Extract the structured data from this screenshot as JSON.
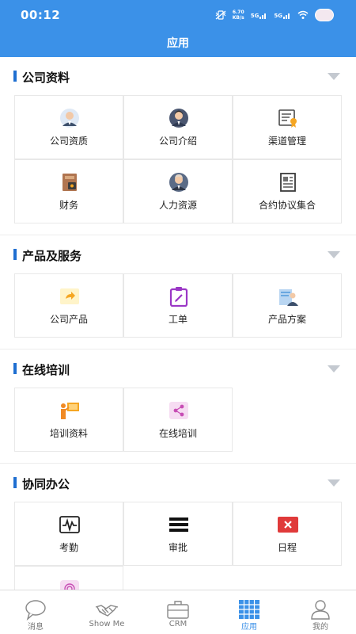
{
  "status_bar": {
    "time": "00:12",
    "net_speed": "6.70",
    "net_unit": "KB/s",
    "signal_1": "5G",
    "signal_2": "5G",
    "icons": [
      "vibrate-icon",
      "signal-icon",
      "wifi-icon",
      "avatar"
    ]
  },
  "header": {
    "title": "应用"
  },
  "sections": [
    {
      "title": "公司资料",
      "tiles": [
        {
          "label": "公司资质",
          "icon": "person-avatar-icon"
        },
        {
          "label": "公司介绍",
          "icon": "businessman-icon"
        },
        {
          "label": "渠道管理",
          "icon": "certificate-icon"
        },
        {
          "label": "财务",
          "icon": "finance-icon"
        },
        {
          "label": "人力资源",
          "icon": "hr-person-icon"
        },
        {
          "label": "合约协议集合",
          "icon": "contract-icon"
        }
      ]
    },
    {
      "title": "产品及服务",
      "tiles": [
        {
          "label": "公司产品",
          "icon": "share-folder-icon"
        },
        {
          "label": "工单",
          "icon": "clipboard-edit-icon"
        },
        {
          "label": "产品方案",
          "icon": "presenter-icon"
        }
      ]
    },
    {
      "title": "在线培训",
      "tiles": [
        {
          "label": "培训资料",
          "icon": "teacher-board-icon"
        },
        {
          "label": "在线培训",
          "icon": "share-nodes-icon"
        }
      ]
    },
    {
      "title": "协同办公",
      "tiles": [
        {
          "label": "考勤",
          "icon": "pulse-icon"
        },
        {
          "label": "审批",
          "icon": "menu-lines-icon"
        },
        {
          "label": "日程",
          "icon": "close-calendar-icon"
        },
        {
          "label": "",
          "icon": "fingerprint-icon"
        }
      ]
    }
  ],
  "tabbar": [
    {
      "label": "消息",
      "icon": "chat-bubble-icon",
      "active": false
    },
    {
      "label": "Show Me",
      "icon": "handshake-icon",
      "active": false
    },
    {
      "label": "CRM",
      "icon": "briefcase-icon",
      "active": false
    },
    {
      "label": "应用",
      "icon": "apps-grid-icon",
      "active": true
    },
    {
      "label": "我的",
      "icon": "user-icon",
      "active": false
    }
  ],
  "colors": {
    "primary": "#3b91e8",
    "section_bar": "#1f6fd1",
    "arrow": "#c4c9d0",
    "orange": "#f5a623",
    "purple": "#9b37c6",
    "red": "#e03a3a"
  }
}
